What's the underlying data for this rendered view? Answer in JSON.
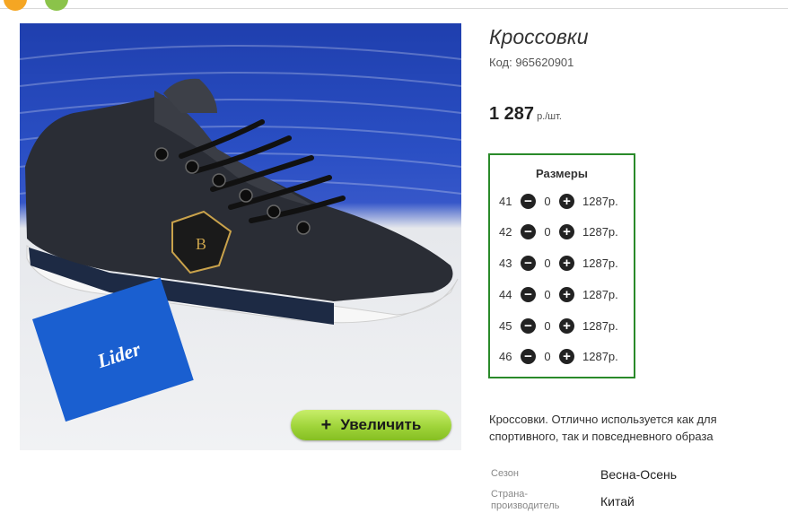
{
  "product": {
    "title": "Кроссовки",
    "code_label": "Код: 965620901",
    "price_amount": "1 287",
    "price_unit": "р./шт.",
    "zoom_label": "Увеличить",
    "zoom_plus": "+",
    "description": "Кроссовки. Отлично используется как для спортивного, так и повседневного образа"
  },
  "sizes": {
    "title": "Размеры",
    "rows": [
      {
        "size": "41",
        "qty": "0",
        "price": "1287р."
      },
      {
        "size": "42",
        "qty": "0",
        "price": "1287р."
      },
      {
        "size": "43",
        "qty": "0",
        "price": "1287р."
      },
      {
        "size": "44",
        "qty": "0",
        "price": "1287р."
      },
      {
        "size": "45",
        "qty": "0",
        "price": "1287р."
      },
      {
        "size": "46",
        "qty": "0",
        "price": "1287р."
      }
    ]
  },
  "specs": [
    {
      "label": "Сезон",
      "value": "Весна-Осень"
    },
    {
      "label": "Страна-производитель",
      "value": "Китай"
    }
  ],
  "colors": {
    "accent_green": "#2a8a2a",
    "button_green": "#9fd43a"
  }
}
